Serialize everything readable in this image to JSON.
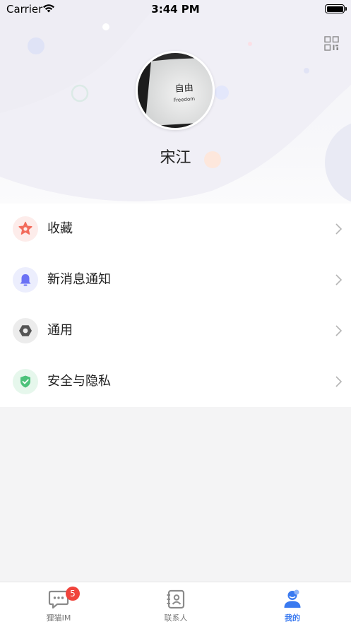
{
  "status_bar": {
    "carrier": "Carrier",
    "time": "3:44 PM",
    "battery_level": 1.0
  },
  "profile": {
    "name": "宋江",
    "avatar_text_cn": "自由",
    "avatar_text_en": "Freedom"
  },
  "menu": {
    "items": [
      {
        "label": "收藏",
        "icon": "star-icon",
        "color": "#f26b5b",
        "bg": "#fdecea"
      },
      {
        "label": "新消息通知",
        "icon": "bell-icon",
        "color": "#6b72f5",
        "bg": "#eceefd"
      },
      {
        "label": "通用",
        "icon": "hexagon-nut-icon",
        "color": "#555555",
        "bg": "#ececec"
      },
      {
        "label": "安全与隐私",
        "icon": "shield-check-icon",
        "color": "#4cc27a",
        "bg": "#e6f7ec"
      }
    ]
  },
  "tabbar": {
    "tabs": [
      {
        "label": "狸猫IM",
        "icon": "chat-bubble-icon",
        "badge": "5"
      },
      {
        "label": "联系人",
        "icon": "contacts-book-icon"
      },
      {
        "label": "我的",
        "icon": "person-icon",
        "active": true
      }
    ]
  },
  "colors": {
    "accent": "#3a7af0",
    "badge": "#f0443c"
  }
}
